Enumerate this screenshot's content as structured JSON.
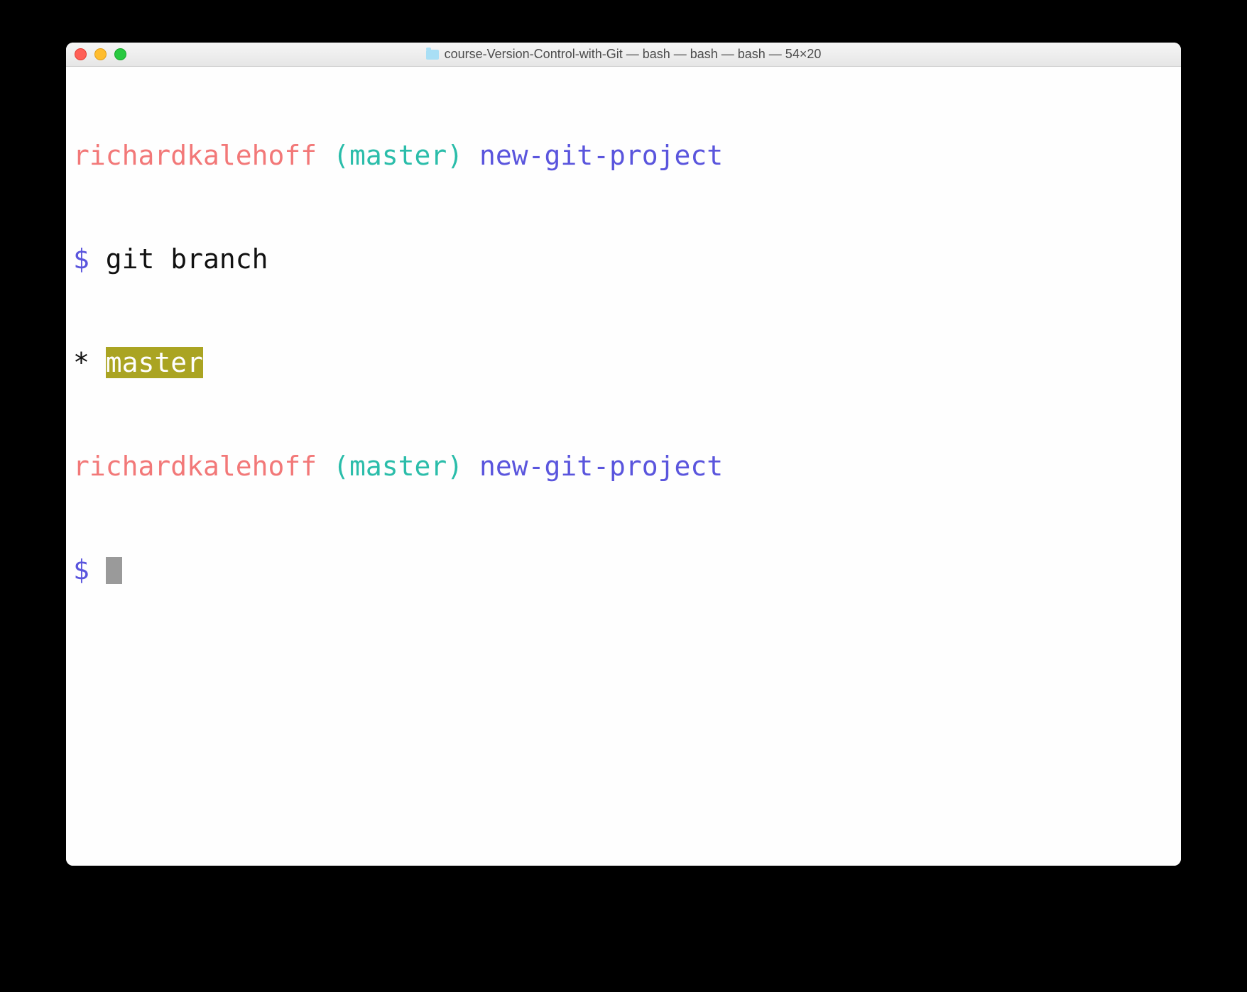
{
  "window": {
    "title": "course-Version-Control-with-Git — bash — bash — bash — 54×20"
  },
  "terminal": {
    "prompt1": {
      "user": "richardkalehoff",
      "branch_open": " (",
      "branch": "master",
      "branch_close": ") ",
      "project": "new-git-project"
    },
    "line1_prompt": "$ ",
    "line1_cmd": "git branch",
    "branch_output": {
      "star": "* ",
      "name": "master"
    },
    "prompt2": {
      "user": "richardkalehoff",
      "branch_open": " (",
      "branch": "master",
      "branch_close": ") ",
      "project": "new-git-project"
    },
    "line2_prompt": "$ "
  }
}
